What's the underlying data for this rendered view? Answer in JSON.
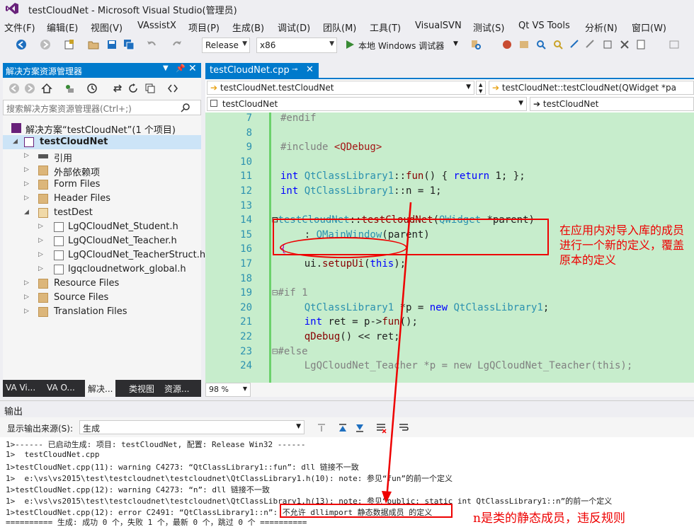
{
  "window": {
    "title": "testCloudNet - Microsoft Visual Studio(管理员)"
  },
  "menu": [
    "文件(F)",
    "编辑(E)",
    "视图(V)",
    "VAssistX",
    "项目(P)",
    "生成(B)",
    "调试(D)",
    "团队(M)",
    "工具(T)",
    "VisualSVN",
    "测试(S)",
    "Qt VS Tools",
    "分析(N)",
    "窗口(W)"
  ],
  "toolbar": {
    "config": "Release",
    "platform": "x86",
    "debug_label": "本地 Windows 调试器"
  },
  "solution_explorer": {
    "header": "解决方案资源管理器",
    "search_placeholder": "搜索解决方案资源管理器(Ctrl+;)",
    "items": [
      {
        "label": "解决方案“testCloudNet”(1 个项目)",
        "icon": "solution-icon"
      },
      {
        "label": "testCloudNet",
        "icon": "project-icon"
      },
      {
        "label": "引用",
        "icon": "references-icon"
      },
      {
        "label": "外部依赖项",
        "icon": "folder-icon"
      },
      {
        "label": "Form Files",
        "icon": "folder-icon"
      },
      {
        "label": "Header Files",
        "icon": "folder-icon"
      },
      {
        "label": "testDest",
        "icon": "folder-icon"
      },
      {
        "label": "LgQCloudNet_Student.h",
        "icon": "header-file-icon"
      },
      {
        "label": "LgQCloudNet_Teacher.h",
        "icon": "header-file-icon"
      },
      {
        "label": "LgQCloudNet_TeacherStruct.h",
        "icon": "header-file-icon"
      },
      {
        "label": "lgqcloudnetwork_global.h",
        "icon": "header-file-icon"
      },
      {
        "label": "Resource Files",
        "icon": "folder-icon"
      },
      {
        "label": "Source Files",
        "icon": "folder-icon"
      },
      {
        "label": "Translation Files",
        "icon": "folder-icon"
      }
    ],
    "tabs": [
      "VA Vi...",
      "VA O...",
      "解决...",
      "类视图",
      "资源..."
    ]
  },
  "editor": {
    "tab": "testCloudNet.cpp",
    "nav_project": "testCloudNet.testCloudNet",
    "nav_member": "testCloudNet::testCloudNet(QWidget *pa",
    "scope": "testCloudNet",
    "scope_member": "testCloudNet",
    "zoom": "98 %",
    "line_numbers": [
      "7",
      "8",
      "9",
      "10",
      "11",
      "12",
      "13",
      "14",
      "15",
      "16",
      "17",
      "18",
      "19",
      "20",
      "21",
      "22",
      "23",
      "24"
    ],
    "annotation": "在应用内对导入库的成员进行一个新的定义，覆盖原本的定义"
  },
  "output": {
    "header": "输出",
    "source_label": "显示输出来源(S):",
    "source_value": "生成",
    "lines": [
      "1>------ 已启动生成: 项目: testCloudNet, 配置: Release Win32 ------",
      "1>  testCloudNet.cpp",
      "1>testCloudNet.cpp(11): warning C4273: “QtClassLibrary1::fun”: dll 链接不一致",
      "1>  e:\\vs\\vs2015\\test\\testcloudnet\\testcloudnet\\QtClassLibrary1.h(10): note: 参见“fun”的前一个定义",
      "1>testCloudNet.cpp(12): warning C4273: “n”: dll 链接不一致",
      "1>  e:\\vs\\vs2015\\test\\testcloudnet\\testcloudnet\\QtClassLibrary1.h(13): note: 参见“public: static int QtClassLibrary1::n”的前一个定义",
      "1>testCloudNet.cpp(12): error C2491: “QtClassLibrary1::n”: 不允许 dllimport 静态数据成员 的定义",
      "========== 生成: 成功 0 个，失败 1 个，最新 0 个，跳过 0 个 =========="
    ],
    "annotation": "n是类的静态成员，违反规则"
  }
}
